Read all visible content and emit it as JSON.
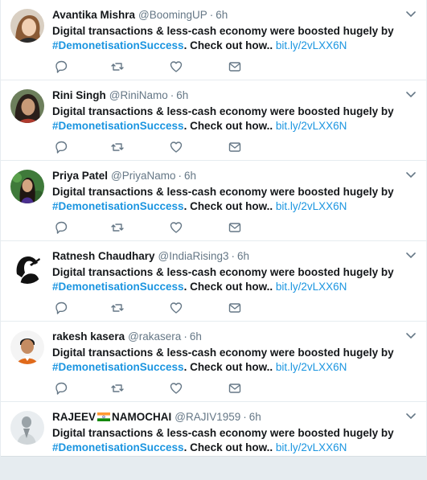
{
  "tweets": [
    {
      "name": "Avantika Mishra",
      "handle": "@BoomingUP",
      "time": "6h",
      "text_bold": "Digital transactions & less-cash economy were boosted hugely by",
      "hashtag": "#DemonetisationSuccess",
      "text_tail": ". Check out how..",
      "link": "bit.ly/2vLXX6N"
    },
    {
      "name": "Rini Singh",
      "handle": "@RiniNamo",
      "time": "6h",
      "text_bold": "Digital transactions & less-cash economy were boosted hugely by",
      "hashtag": "#DemonetisationSuccess",
      "text_tail": ". Check out how..",
      "link": "bit.ly/2vLXX6N"
    },
    {
      "name": "Priya Patel",
      "handle": "@PriyaNamo",
      "time": "6h",
      "text_bold": "Digital transactions & less-cash economy were boosted hugely by",
      "hashtag": "#DemonetisationSuccess",
      "text_tail": ". Check out how..",
      "link": "bit.ly/2vLXX6N"
    },
    {
      "name": "Ratnesh Chaudhary",
      "handle": "@IndiaRising3",
      "time": "6h",
      "text_bold": "Digital transactions & less-cash economy were boosted hugely by",
      "hashtag": "#DemonetisationSuccess",
      "text_tail": ". Check out how..",
      "link": "bit.ly/2vLXX6N"
    },
    {
      "name": "rakesh kasera",
      "handle": "@rakasera",
      "time": "6h",
      "text_bold": "Digital transactions & less-cash economy were boosted hugely by",
      "hashtag": "#DemonetisationSuccess",
      "text_tail": ". Check out how..",
      "link": "bit.ly/2vLXX6N"
    },
    {
      "name_pre": "RAJEEV",
      "name_post": "NAMOCHAI",
      "handle": "@RAJIV1959",
      "time": "6h",
      "text_bold": "Digital transactions & less-cash economy were boosted hugely by",
      "hashtag": "#DemonetisationSuccess",
      "text_tail": ". Check out how..",
      "link": "bit.ly/2vLXX6N"
    }
  ],
  "separator": "·",
  "icons": {
    "reply": "reply-icon",
    "retweet": "retweet-icon",
    "like": "like-icon",
    "dm": "direct-message-icon",
    "menu": "chevron-down-icon",
    "flag": "india-flag-icon"
  },
  "colors": {
    "link": "#1b95e0",
    "text": "#14171a",
    "secondary": "#657786",
    "border": "#e6ecf0",
    "background": "#e6ecf0"
  }
}
